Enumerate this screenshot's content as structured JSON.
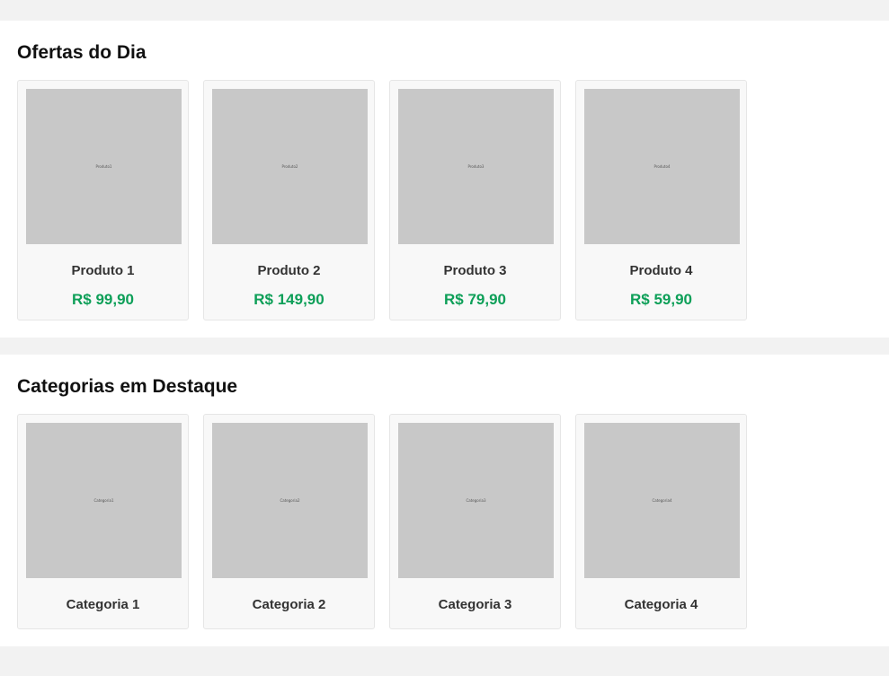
{
  "colors": {
    "price": "#0d9f58",
    "page_background": "#f2f2f2",
    "placeholder": "#c8c8c8"
  },
  "deals": {
    "title": "Ofertas do Dia",
    "products": [
      {
        "name": "Produto 1",
        "price": "R$ 99,90",
        "image_text": "Produto1"
      },
      {
        "name": "Produto 2",
        "price": "R$ 149,90",
        "image_text": "Produto2"
      },
      {
        "name": "Produto 3",
        "price": "R$ 79,90",
        "image_text": "Produto3"
      },
      {
        "name": "Produto 4",
        "price": "R$ 59,90",
        "image_text": "Produto4"
      }
    ]
  },
  "categories": {
    "title": "Categorias em Destaque",
    "items": [
      {
        "name": "Categoria 1",
        "image_text": "Categoria1"
      },
      {
        "name": "Categoria 2",
        "image_text": "Categoria2"
      },
      {
        "name": "Categoria 3",
        "image_text": "Categoria3"
      },
      {
        "name": "Categoria 4",
        "image_text": "Categoria4"
      }
    ]
  }
}
